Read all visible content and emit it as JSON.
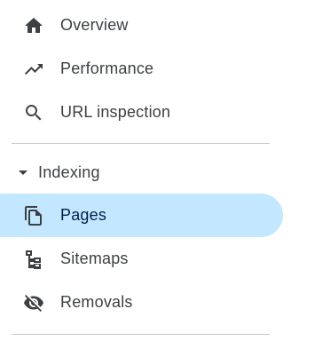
{
  "nav": {
    "items": [
      {
        "label": "Overview",
        "icon": "home-icon"
      },
      {
        "label": "Performance",
        "icon": "trending-up-icon"
      },
      {
        "label": "URL inspection",
        "icon": "search-icon"
      }
    ],
    "indexing": {
      "label": "Indexing",
      "icon": "caret-down-icon",
      "items": [
        {
          "label": "Pages",
          "icon": "pages-copy-icon",
          "active": true
        },
        {
          "label": "Sitemaps",
          "icon": "sitemap-icon"
        },
        {
          "label": "Removals",
          "icon": "visibility-off-icon"
        }
      ]
    }
  },
  "colors": {
    "active_background": "#c2e7ff",
    "text": "#3c4043",
    "divider": "#c4c7c5"
  }
}
